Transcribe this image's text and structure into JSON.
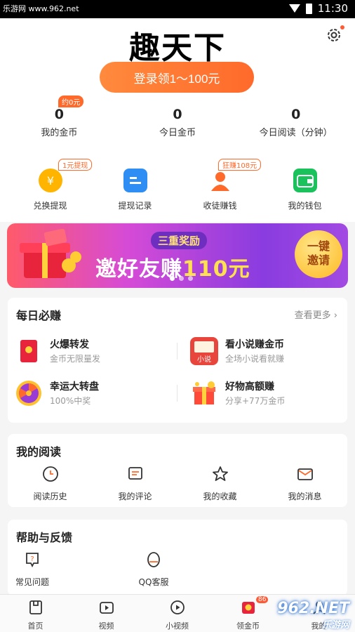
{
  "status_bar": {
    "watermark": "乐游网 www.962.net",
    "time": "11:30"
  },
  "header": {
    "title": "趣天下",
    "login_button": "登录领1～100元"
  },
  "stats": [
    {
      "value": "0",
      "label": "我的金币",
      "badge": "约0元"
    },
    {
      "value": "0",
      "label": "今日金币"
    },
    {
      "value": "0",
      "label": "今日阅读（分钟）"
    }
  ],
  "actions": [
    {
      "label": "兑换提现",
      "tag": "1元提现",
      "icon": "coin-icon",
      "color": "#ffb400"
    },
    {
      "label": "提现记录",
      "icon": "record-icon",
      "color": "#2f8ef4"
    },
    {
      "label": "收徒赚钱",
      "tag": "狂赚108元",
      "icon": "apprentice-icon",
      "color": "#ff6a2b"
    },
    {
      "label": "我的钱包",
      "icon": "wallet-icon",
      "color": "#19c25b"
    }
  ],
  "banner": {
    "subtitle": "三重奖励",
    "headline": "邀好友赚",
    "amount": "110元",
    "invite_line1": "一键",
    "invite_line2": "邀请"
  },
  "daily": {
    "title": "每日必赚",
    "more": "查看更多",
    "tasks": [
      {
        "title": "火爆转发",
        "subtitle": "金币无限量发",
        "icon": "red-envelope-icon"
      },
      {
        "title": "看小说赚金币",
        "subtitle": "全场小说看就赚",
        "icon": "novel-icon",
        "icon_text": "小说"
      },
      {
        "title": "幸运大转盘",
        "subtitle": "100%中奖",
        "icon": "wheel-icon"
      },
      {
        "title": "好物高额赚",
        "subtitle": "分享+77万金币",
        "icon": "gift-box-icon"
      }
    ]
  },
  "reading": {
    "title": "我的阅读",
    "items": [
      {
        "label": "阅读历史",
        "icon": "clock-icon"
      },
      {
        "label": "我的评论",
        "icon": "comment-icon"
      },
      {
        "label": "我的收藏",
        "icon": "star-icon"
      },
      {
        "label": "我的消息",
        "icon": "mail-icon"
      }
    ]
  },
  "help": {
    "title": "帮助与反馈",
    "items": [
      {
        "label": "常见问题",
        "icon": "question-icon"
      },
      {
        "label": "QQ客服",
        "icon": "qq-icon"
      }
    ]
  },
  "tabbar": [
    {
      "label": "首页",
      "icon": "home-icon"
    },
    {
      "label": "视频",
      "icon": "video-icon"
    },
    {
      "label": "小视频",
      "icon": "short-video-icon"
    },
    {
      "label": "领金币",
      "icon": "coin-envelope-icon",
      "badge": "86"
    },
    {
      "label": "我的",
      "icon": "profile-icon"
    }
  ],
  "watermark_corner": {
    "main": "962.NET",
    "sub": "乐游网"
  },
  "colors": {
    "accent": "#ff6a2b",
    "banner_start": "#ff5a6a",
    "banner_end": "#8a3ce0"
  }
}
